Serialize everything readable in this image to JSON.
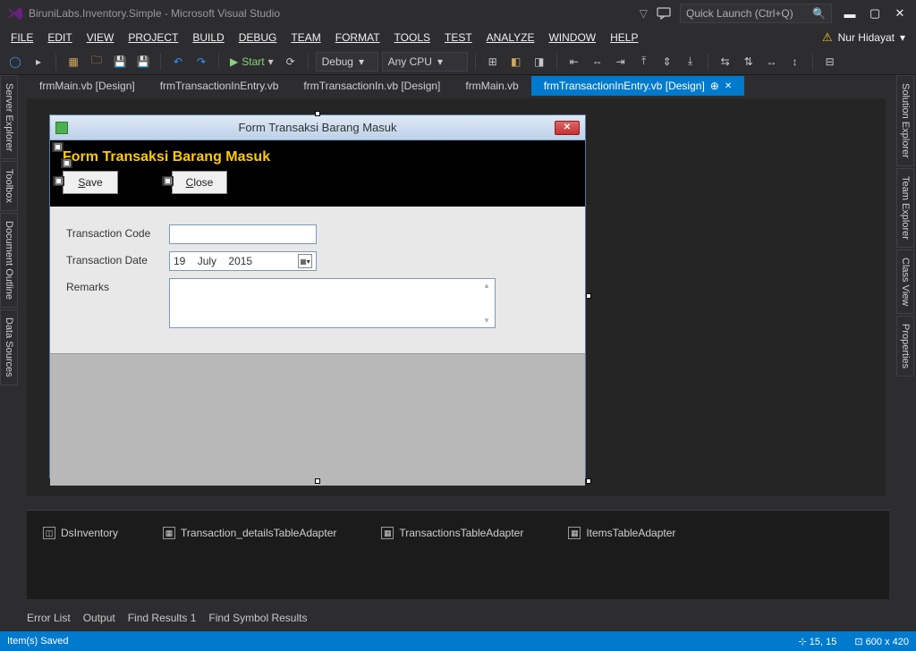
{
  "titlebar": {
    "title": "BiruniLabs.Inventory.Simple - Microsoft Visual Studio",
    "quick_placeholder": "Quick Launch (Ctrl+Q)"
  },
  "menu": [
    "FILE",
    "EDIT",
    "VIEW",
    "PROJECT",
    "BUILD",
    "DEBUG",
    "TEAM",
    "FORMAT",
    "TOOLS",
    "TEST",
    "ANALYZE",
    "WINDOW",
    "HELP"
  ],
  "user": "Nur Hidayat",
  "toolbar": {
    "start": "Start",
    "config": "Debug",
    "platform": "Any CPU"
  },
  "tabs": [
    {
      "label": "frmMain.vb [Design]"
    },
    {
      "label": "frmTransactionInEntry.vb"
    },
    {
      "label": "frmTransactionIn.vb [Design]"
    },
    {
      "label": "frmMain.vb"
    },
    {
      "label": "frmTransactionInEntry.vb [Design]",
      "active": true
    }
  ],
  "left_tabs": [
    "Server Explorer",
    "Toolbox",
    "Document Outline",
    "Data Sources"
  ],
  "right_tabs": [
    "Solution Explorer",
    "Team Explorer",
    "Class View",
    "Properties"
  ],
  "form": {
    "window_title": "Form Transaksi Barang Masuk",
    "header_title": "Form Transaksi Barang Masuk",
    "save": "Save",
    "close": "Close",
    "labels": {
      "code": "Transaction Code",
      "date": "Transaction Date",
      "remarks": "Remarks"
    },
    "date_value": {
      "d": "19",
      "m": "July",
      "y": "2015"
    }
  },
  "tray": [
    "DsInventory",
    "Transaction_detailsTableAdapter",
    "TransactionsTableAdapter",
    "ItemsTableAdapter"
  ],
  "bottom_tabs": [
    "Error List",
    "Output",
    "Find Results 1",
    "Find Symbol Results"
  ],
  "status": {
    "left": "Item(s) Saved",
    "pos": "15, 15",
    "size": "600 x 420"
  }
}
